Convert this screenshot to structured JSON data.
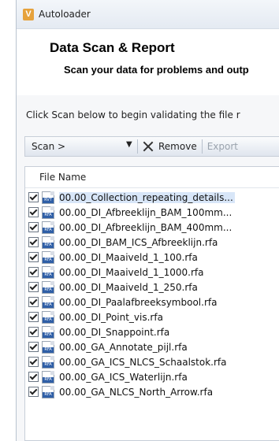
{
  "window": {
    "app_title": "Autoloader",
    "app_icon_letter": "V"
  },
  "header": {
    "title": "Data Scan & Report",
    "subtitle": "Scan your data for problems and outp"
  },
  "body": {
    "instruction": "Click Scan below to begin validating the file r"
  },
  "toolbar": {
    "scan_label": "Scan >",
    "scan_dropdown_glyph": "▼",
    "remove_label": "Remove",
    "export_label": "Export"
  },
  "file_list": {
    "column_header": "File Name",
    "rows": [
      {
        "name": "00.00_Collection_repeating_details...",
        "type": "RVT",
        "checked": true,
        "selected": true
      },
      {
        "name": "00.00_DI_Afbreeklijn_BAM_100mm...",
        "type": "RFA",
        "checked": true,
        "selected": false
      },
      {
        "name": "00.00_DI_Afbreeklijn_BAM_400mm...",
        "type": "RFA",
        "checked": true,
        "selected": false
      },
      {
        "name": "00.00_DI_BAM_ICS_Afbreeklijn.rfa",
        "type": "RFA",
        "checked": true,
        "selected": false
      },
      {
        "name": "00.00_DI_Maaiveld_1_100.rfa",
        "type": "RFA",
        "checked": true,
        "selected": false
      },
      {
        "name": "00.00_DI_Maaiveld_1_1000.rfa",
        "type": "RFA",
        "checked": true,
        "selected": false
      },
      {
        "name": "00.00_DI_Maaiveld_1_250.rfa",
        "type": "RFA",
        "checked": true,
        "selected": false
      },
      {
        "name": "00.00_DI_Paalafbreeksymbool.rfa",
        "type": "RFA",
        "checked": true,
        "selected": false
      },
      {
        "name": "00.00_DI_Point_vis.rfa",
        "type": "RFA",
        "checked": true,
        "selected": false
      },
      {
        "name": "00.00_DI_Snappoint.rfa",
        "type": "RFA",
        "checked": true,
        "selected": false
      },
      {
        "name": "00.00_GA_Annotate_pijl.rfa",
        "type": "RFA",
        "checked": true,
        "selected": false
      },
      {
        "name": "00.00_GA_ICS_NLCS_Schaalstok.rfa",
        "type": "RFA",
        "checked": true,
        "selected": false
      },
      {
        "name": "00.00_GA_ICS_Waterlijn.rfa",
        "type": "RFA",
        "checked": true,
        "selected": false
      },
      {
        "name": "00.00_GA_NLCS_North_Arrow.rfa",
        "type": "RFA",
        "checked": true,
        "selected": false
      }
    ]
  },
  "colors": {
    "file_tag_blue": "#2f5fa7",
    "selection": "#d8e6f8",
    "app_icon_orange": "#e6a23c"
  }
}
